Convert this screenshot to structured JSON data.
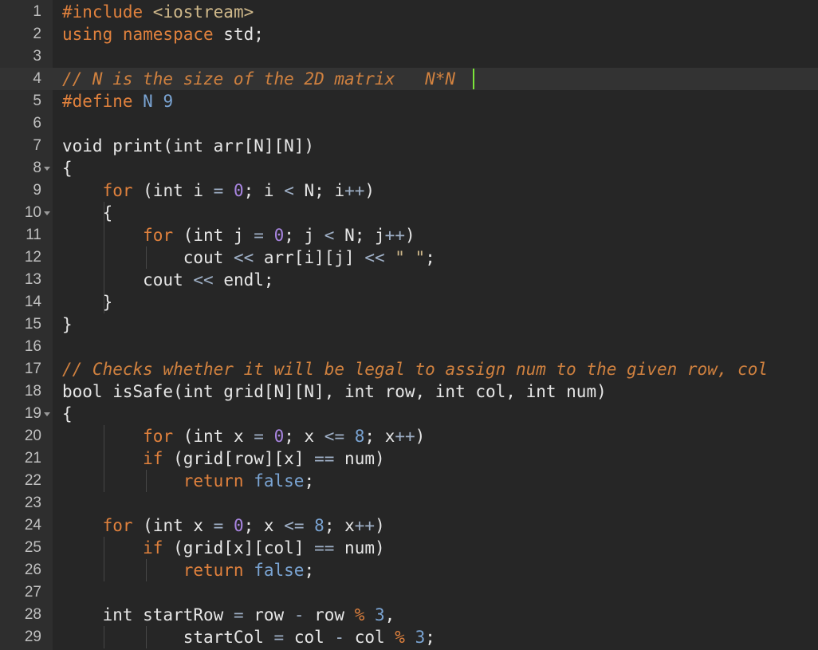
{
  "colors": {
    "background": "#262626",
    "gutter": "#2e2e2e",
    "active_line": "#333333",
    "keyword": "#e0813d",
    "comment": "#d0813f",
    "number": "#a885e0",
    "literal": "#7aa4d3",
    "text": "#e6e6e6",
    "cursor": "#7be63a"
  },
  "editor": {
    "cursor_line": 4,
    "fold_lines": [
      8,
      10,
      19
    ],
    "lines": [
      {
        "n": "1",
        "tokens": [
          {
            "t": "#include ",
            "c": "pp"
          },
          {
            "t": "<iostream>",
            "c": "str"
          }
        ]
      },
      {
        "n": "2",
        "tokens": [
          {
            "t": "using namespace",
            "c": "kw"
          },
          {
            "t": " std;",
            "c": "id"
          }
        ]
      },
      {
        "n": "3",
        "tokens": []
      },
      {
        "n": "4",
        "tokens": [
          {
            "t": "// N is the size of the 2D matrix   N*N",
            "c": "cm"
          }
        ]
      },
      {
        "n": "5",
        "tokens": [
          {
            "t": "#define",
            "c": "pp"
          },
          {
            "t": " N ",
            "c": "lit"
          },
          {
            "t": "9",
            "c": "lit"
          }
        ]
      },
      {
        "n": "6",
        "tokens": []
      },
      {
        "n": "7",
        "tokens": [
          {
            "t": "void print(int arr[N][N])",
            "c": "id"
          }
        ]
      },
      {
        "n": "8",
        "tokens": [
          {
            "t": "{",
            "c": "id"
          }
        ]
      },
      {
        "n": "9",
        "tokens": [
          {
            "t": "    ",
            "c": "id"
          },
          {
            "t": "for",
            "c": "kw"
          },
          {
            "t": " (int i ",
            "c": "id"
          },
          {
            "t": "=",
            "c": "op"
          },
          {
            "t": " ",
            "c": "id"
          },
          {
            "t": "0",
            "c": "num"
          },
          {
            "t": "; i ",
            "c": "id"
          },
          {
            "t": "<",
            "c": "op"
          },
          {
            "t": " N; i",
            "c": "id"
          },
          {
            "t": "++",
            "c": "op"
          },
          {
            "t": ")",
            "c": "id"
          }
        ]
      },
      {
        "n": "10",
        "tokens": [
          {
            "t": "    {",
            "c": "id"
          }
        ]
      },
      {
        "n": "11",
        "tokens": [
          {
            "t": "        ",
            "c": "id"
          },
          {
            "t": "for",
            "c": "kw"
          },
          {
            "t": " (int j ",
            "c": "id"
          },
          {
            "t": "=",
            "c": "op"
          },
          {
            "t": " ",
            "c": "id"
          },
          {
            "t": "0",
            "c": "num"
          },
          {
            "t": "; j ",
            "c": "id"
          },
          {
            "t": "<",
            "c": "op"
          },
          {
            "t": " N; j",
            "c": "id"
          },
          {
            "t": "++",
            "c": "op"
          },
          {
            "t": ")",
            "c": "id"
          }
        ]
      },
      {
        "n": "12",
        "tokens": [
          {
            "t": "            cout ",
            "c": "id"
          },
          {
            "t": "<<",
            "c": "op"
          },
          {
            "t": " arr[i][j] ",
            "c": "id"
          },
          {
            "t": "<<",
            "c": "op"
          },
          {
            "t": " ",
            "c": "id"
          },
          {
            "t": "\" \"",
            "c": "str"
          },
          {
            "t": ";",
            "c": "id"
          }
        ]
      },
      {
        "n": "13",
        "tokens": [
          {
            "t": "        cout ",
            "c": "id"
          },
          {
            "t": "<<",
            "c": "op"
          },
          {
            "t": " endl;",
            "c": "id"
          }
        ]
      },
      {
        "n": "14",
        "tokens": [
          {
            "t": "    }",
            "c": "id"
          }
        ]
      },
      {
        "n": "15",
        "tokens": [
          {
            "t": "}",
            "c": "id"
          }
        ]
      },
      {
        "n": "16",
        "tokens": []
      },
      {
        "n": "17",
        "tokens": [
          {
            "t": "// Checks whether it will be legal to assign num to the given row, col",
            "c": "cm"
          }
        ]
      },
      {
        "n": "18",
        "tokens": [
          {
            "t": "bool isSafe(int grid[N][N], int row, int col, int num)",
            "c": "id"
          }
        ]
      },
      {
        "n": "19",
        "tokens": [
          {
            "t": "{",
            "c": "id"
          }
        ]
      },
      {
        "n": "20",
        "tokens": [
          {
            "t": "        ",
            "c": "id"
          },
          {
            "t": "for",
            "c": "kw"
          },
          {
            "t": " (int x ",
            "c": "id"
          },
          {
            "t": "=",
            "c": "op"
          },
          {
            "t": " ",
            "c": "id"
          },
          {
            "t": "0",
            "c": "num"
          },
          {
            "t": "; x ",
            "c": "id"
          },
          {
            "t": "<=",
            "c": "op"
          },
          {
            "t": " ",
            "c": "id"
          },
          {
            "t": "8",
            "c": "lit"
          },
          {
            "t": "; x",
            "c": "id"
          },
          {
            "t": "++",
            "c": "op"
          },
          {
            "t": ")",
            "c": "id"
          }
        ]
      },
      {
        "n": "21",
        "tokens": [
          {
            "t": "        ",
            "c": "id"
          },
          {
            "t": "if",
            "c": "kw"
          },
          {
            "t": " (grid[row][x] ",
            "c": "id"
          },
          {
            "t": "==",
            "c": "op"
          },
          {
            "t": " num)",
            "c": "id"
          }
        ]
      },
      {
        "n": "22",
        "tokens": [
          {
            "t": "            ",
            "c": "id"
          },
          {
            "t": "return",
            "c": "kw"
          },
          {
            "t": " ",
            "c": "id"
          },
          {
            "t": "false",
            "c": "lit"
          },
          {
            "t": ";",
            "c": "id"
          }
        ]
      },
      {
        "n": "23",
        "tokens": []
      },
      {
        "n": "24",
        "tokens": [
          {
            "t": "    ",
            "c": "id"
          },
          {
            "t": "for",
            "c": "kw"
          },
          {
            "t": " (int x ",
            "c": "id"
          },
          {
            "t": "=",
            "c": "op"
          },
          {
            "t": " ",
            "c": "id"
          },
          {
            "t": "0",
            "c": "num"
          },
          {
            "t": "; x ",
            "c": "id"
          },
          {
            "t": "<=",
            "c": "op"
          },
          {
            "t": " ",
            "c": "id"
          },
          {
            "t": "8",
            "c": "lit"
          },
          {
            "t": "; x",
            "c": "id"
          },
          {
            "t": "++",
            "c": "op"
          },
          {
            "t": ")",
            "c": "id"
          }
        ]
      },
      {
        "n": "25",
        "tokens": [
          {
            "t": "        ",
            "c": "id"
          },
          {
            "t": "if",
            "c": "kw"
          },
          {
            "t": " (grid[x][col] ",
            "c": "id"
          },
          {
            "t": "==",
            "c": "op"
          },
          {
            "t": " num)",
            "c": "id"
          }
        ]
      },
      {
        "n": "26",
        "tokens": [
          {
            "t": "            ",
            "c": "id"
          },
          {
            "t": "return",
            "c": "kw"
          },
          {
            "t": " ",
            "c": "id"
          },
          {
            "t": "false",
            "c": "lit"
          },
          {
            "t": ";",
            "c": "id"
          }
        ]
      },
      {
        "n": "27",
        "tokens": []
      },
      {
        "n": "28",
        "tokens": [
          {
            "t": "    int startRow ",
            "c": "id"
          },
          {
            "t": "=",
            "c": "op"
          },
          {
            "t": " row ",
            "c": "id"
          },
          {
            "t": "-",
            "c": "op"
          },
          {
            "t": " row ",
            "c": "id"
          },
          {
            "t": "%",
            "c": "kw"
          },
          {
            "t": " ",
            "c": "id"
          },
          {
            "t": "3",
            "c": "lit"
          },
          {
            "t": ",",
            "c": "id"
          }
        ]
      },
      {
        "n": "29",
        "tokens": [
          {
            "t": "            startCol ",
            "c": "id"
          },
          {
            "t": "=",
            "c": "op"
          },
          {
            "t": " col ",
            "c": "id"
          },
          {
            "t": "-",
            "c": "op"
          },
          {
            "t": " col ",
            "c": "id"
          },
          {
            "t": "%",
            "c": "kw"
          },
          {
            "t": " ",
            "c": "id"
          },
          {
            "t": "3",
            "c": "lit"
          },
          {
            "t": ";",
            "c": "id"
          }
        ]
      }
    ]
  }
}
